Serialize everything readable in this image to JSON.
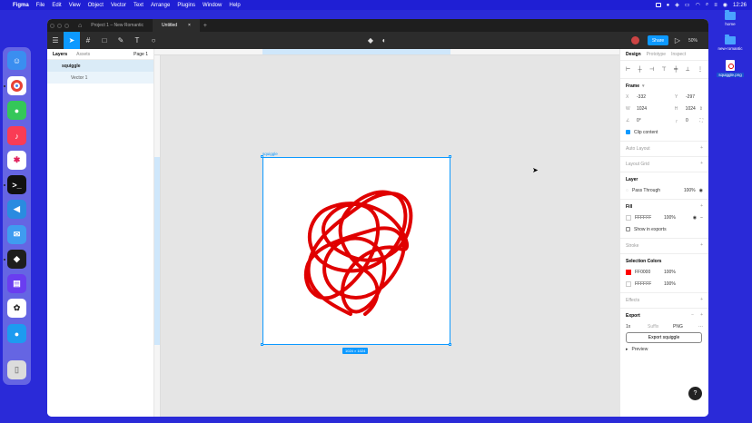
{
  "menubar": {
    "app": "Figma",
    "items": [
      "File",
      "Edit",
      "View",
      "Object",
      "Vector",
      "Text",
      "Arrange",
      "Plugins",
      "Window",
      "Help"
    ],
    "clock": "12:26"
  },
  "desktop": {
    "icons": [
      {
        "label": "home",
        "kind": "folder"
      },
      {
        "label": "new-romantic",
        "kind": "folder"
      },
      {
        "label": "squiggle.png",
        "kind": "file"
      }
    ]
  },
  "dock": {
    "apps": [
      {
        "name": "finder-icon",
        "color": "#3a8ef0"
      },
      {
        "name": "chrome-icon",
        "color": "#ffffff"
      },
      {
        "name": "messages-icon",
        "color": "#34c759"
      },
      {
        "name": "music-icon",
        "color": "#fa3c55"
      },
      {
        "name": "slack-icon",
        "color": "#ffffff"
      },
      {
        "name": "terminal-icon",
        "color": "#111111"
      },
      {
        "name": "vscode-icon",
        "color": "#2a8be0"
      },
      {
        "name": "mail-icon",
        "color": "#3f9cf0"
      },
      {
        "name": "figma-icon",
        "color": "#1e1e1e"
      },
      {
        "name": "stack-icon",
        "color": "#6a3df0"
      },
      {
        "name": "photos-icon",
        "color": "#ffffff"
      },
      {
        "name": "bird-icon",
        "color": "#1d9bf0"
      },
      {
        "name": "trash-icon",
        "color": "#dcdcdc"
      }
    ]
  },
  "tabs": {
    "project": "Project 1 – New Romantic",
    "current": "Untitled",
    "add": "+"
  },
  "toolbar": {
    "share_label": "Share",
    "zoom": "50%"
  },
  "layers": {
    "tab_layers": "Layers",
    "tab_assets": "Assets",
    "page": "Page 1",
    "items": [
      {
        "label": "squiggle"
      },
      {
        "label": "Vector 1"
      }
    ]
  },
  "canvas": {
    "frame_label": "squiggle",
    "dimensions": "1024 × 1024",
    "stroke_color": "#e00000"
  },
  "design": {
    "tabs": [
      "Design",
      "Prototype",
      "Inspect"
    ],
    "frame": {
      "title": "Frame",
      "x_label": "X",
      "x": "-332",
      "y_label": "Y",
      "y": "-297",
      "w_label": "W",
      "w": "1024",
      "h_label": "H",
      "h": "1024",
      "rotation": "0°",
      "radius": "0",
      "clip": "Clip content"
    },
    "auto_layout": "Auto Layout",
    "layout_grid": "Layout Grid",
    "layer": {
      "title": "Layer",
      "mode": "Pass Through",
      "opacity": "100%"
    },
    "fill": {
      "title": "Fill",
      "hex": "FFFFFF",
      "opacity": "100%",
      "show_exports": "Show in exports"
    },
    "stroke": "Stroke",
    "selection_colors": {
      "title": "Selection Colors",
      "colors": [
        {
          "hex": "FF0000",
          "opacity": "100%",
          "swatch": "#ff0000"
        },
        {
          "hex": "FFFFFF",
          "opacity": "100%",
          "swatch": "#ffffff"
        }
      ]
    },
    "effects": "Effects",
    "export": {
      "title": "Export",
      "scale": "1x",
      "suffix": "Suffix",
      "format": "PNG",
      "button": "Export squiggle",
      "preview": "Preview"
    },
    "help": "?"
  }
}
